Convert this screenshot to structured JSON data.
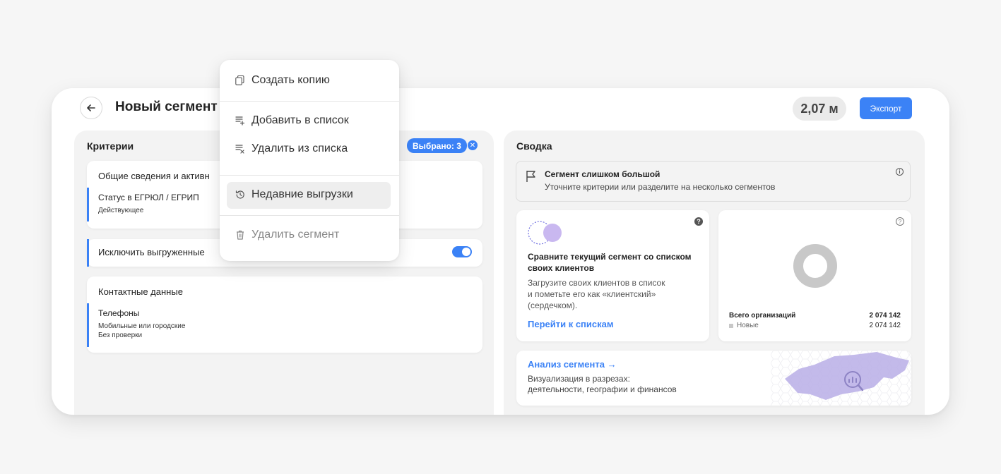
{
  "header": {
    "title": "Новый сегмент",
    "count": "2,07 м",
    "export_label": "Экспорт"
  },
  "criteria": {
    "title": "Критерии",
    "selected_chip": "Выбрано: 3",
    "cards": {
      "general": {
        "title": "Общие сведения и активн",
        "field_label": "Статус в ЕГРЮЛ / ЕГРИП",
        "field_value": "Действующее"
      },
      "exclude": {
        "label": "Исключить выгруженные",
        "toggle_on": true
      },
      "contacts": {
        "title": "Контактные данные",
        "field_label": "Телефоны",
        "field_value_1": "Мобильные или городские",
        "field_value_2": "Без проверки"
      }
    }
  },
  "summary": {
    "title": "Сводка",
    "warning": {
      "title": "Сегмент слишком большой",
      "text": "Уточните критерии или разделите на несколько сегментов"
    },
    "compare": {
      "title_1": "Сравните текущий сегмент со списком",
      "title_2": "своих клиентов",
      "text_1": "Загрузите своих клиентов в список",
      "text_2": "и пометьте его как «клиентский»",
      "text_3": "(сердечком).",
      "link": "Перейти к спискам"
    },
    "stats": {
      "total_label": "Всего организаций",
      "total_value": "2 074 142",
      "new_label": "Новые",
      "new_value": "2 074 142"
    },
    "analysis": {
      "link": "Анализ сегмента →",
      "text_1": "Визуализация в разрезах:",
      "text_2": "деятельности, географии и финансов"
    }
  },
  "menu": {
    "copy": "Создать копию",
    "add_to_list": "Добавить в список",
    "remove_from_list": "Удалить из списка",
    "recent_exports": "Недавние выгрузки",
    "delete": "Удалить сегмент"
  },
  "colors": {
    "accent": "#3b82f6",
    "panel_bg": "#f3f3f3",
    "donut": "#c8c8c8",
    "map": "#b9aee6"
  }
}
